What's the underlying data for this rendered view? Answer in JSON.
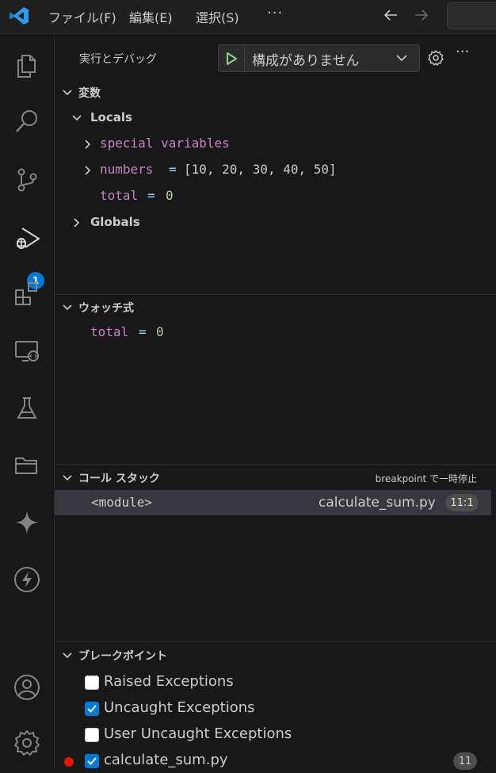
{
  "menu": {
    "file": "ファイル(F)",
    "edit": "編集(E)",
    "selection": "選択(S)",
    "more": "···"
  },
  "activity": {
    "debug_badge": "1"
  },
  "sidebar": {
    "title": "実行とデバッグ",
    "launch_config": "構成がありません",
    "more": "···"
  },
  "variables": {
    "header": "変数",
    "locals_label": "Locals",
    "special": "special variables",
    "numbers_name": "numbers",
    "numbers_value": "[10, 20, 30, 40, 50]",
    "total_name": "total",
    "total_value": "0",
    "equals": "=",
    "globals_label": "Globals"
  },
  "watch": {
    "header": "ウォッチ式",
    "expr_name": "total",
    "expr_value": "0"
  },
  "callstack": {
    "header": "コール スタック",
    "status": "breakpoint で一時停止",
    "frame": "<module>",
    "file": "calculate_sum.py",
    "position": "11:1"
  },
  "breakpoints": {
    "header": "ブレークポイント",
    "items": [
      {
        "label": "Raised Exceptions",
        "checked": false
      },
      {
        "label": "Uncaught Exceptions",
        "checked": true
      },
      {
        "label": "User Uncaught Exceptions",
        "checked": false
      },
      {
        "label": "calculate_sum.py",
        "checked": true,
        "line": "11"
      }
    ]
  },
  "colors": {
    "accent": "#0078d4",
    "breakpoint": "#e51400",
    "play": "#89d185",
    "variable": "#c586c0",
    "number": "#b5cea8"
  }
}
